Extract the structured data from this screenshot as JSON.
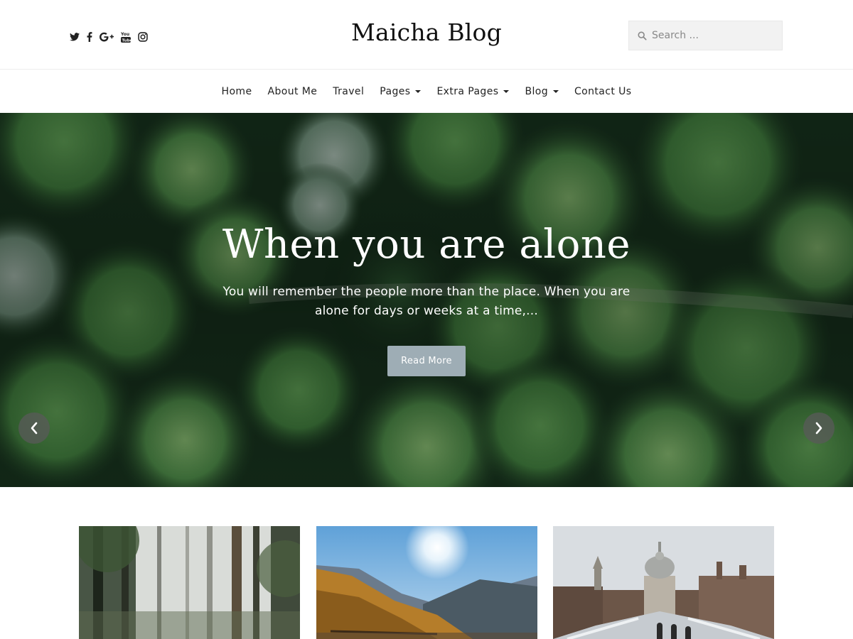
{
  "header": {
    "social": [
      {
        "icon": "twitter-icon"
      },
      {
        "icon": "facebook-icon"
      },
      {
        "icon": "google-plus-icon",
        "label": "G+"
      },
      {
        "icon": "youtube-icon"
      },
      {
        "icon": "instagram-icon"
      }
    ],
    "logo": "Maicha Blog",
    "search": {
      "placeholder": "Search ...",
      "value": ""
    }
  },
  "nav": {
    "items": [
      {
        "label": "Home",
        "dropdown": false
      },
      {
        "label": "About Me",
        "dropdown": false
      },
      {
        "label": "Travel",
        "dropdown": false
      },
      {
        "label": "Pages",
        "dropdown": true
      },
      {
        "label": "Extra Pages",
        "dropdown": true
      },
      {
        "label": "Blog",
        "dropdown": true
      },
      {
        "label": "Contact Us",
        "dropdown": false
      }
    ]
  },
  "hero": {
    "title": "When you are alone",
    "excerpt": "You will remember the people more than the place. When you are alone for days or weeks at a time,...",
    "button": "Read More",
    "prev_icon": "chevron-left-icon",
    "next_icon": "chevron-right-icon"
  },
  "colors": {
    "button_bg": "#9eadb5",
    "hero_overlay": "#163020",
    "arrow_bg": "#5a5a5a"
  },
  "cards": [
    {
      "image": "misty-forest-image"
    },
    {
      "image": "mountain-valley-image"
    },
    {
      "image": "cathedral-city-image"
    }
  ]
}
